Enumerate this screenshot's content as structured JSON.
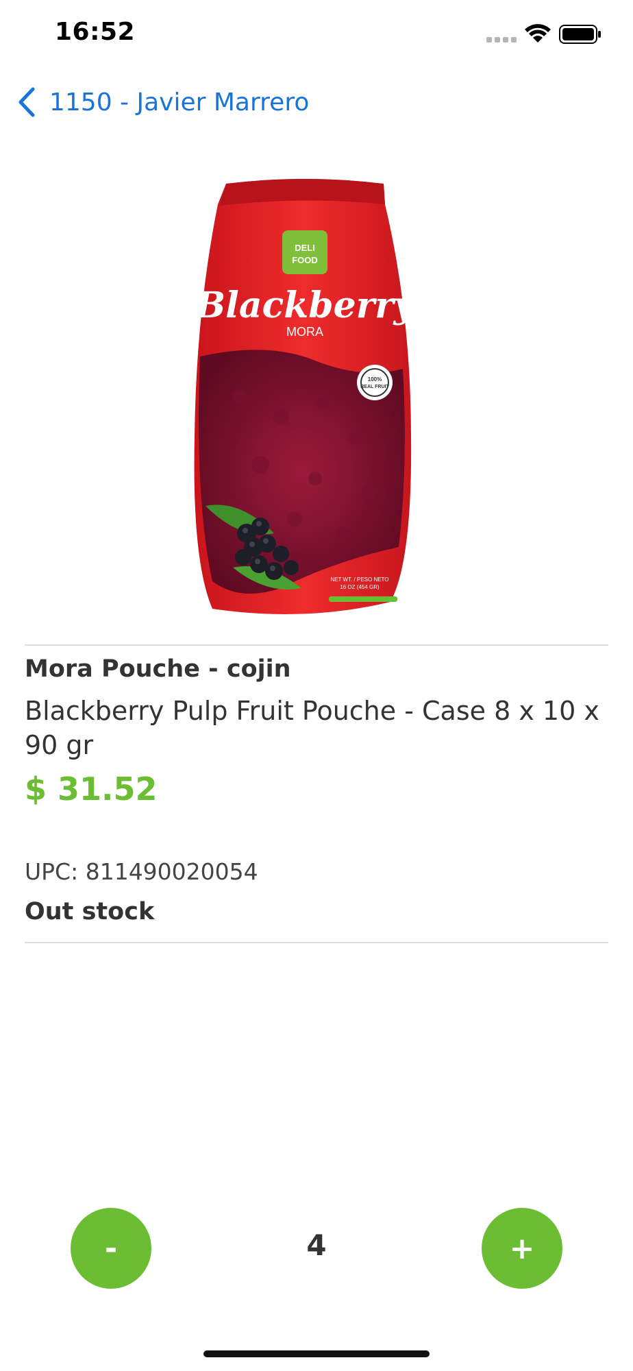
{
  "status_bar": {
    "time": "16:52",
    "icons": [
      "signal-icon",
      "wifi-icon",
      "battery-icon"
    ]
  },
  "nav": {
    "back_label": "1150 - Javier Marrero",
    "back_icon": "chevron-left-icon"
  },
  "product": {
    "image": {
      "brand_logo": "DELI FOOD",
      "name": "Blackberry",
      "subname": "MORA",
      "seal": "100% REAL FRUIT",
      "weight": "NET WT. / PESO NETO 16 OZ (454 GR)"
    },
    "short_name": "Mora Pouche - cojin",
    "full_name": "Blackberry Pulp Fruit Pouche - Case 8 x 10 x 90 gr",
    "price": "$ 31.52",
    "upc": "UPC: 811490020054",
    "stock_status": "Out stock"
  },
  "quantity": {
    "minus_label": "-",
    "value": "4",
    "plus_label": "+"
  },
  "colors": {
    "accent_green": "#6bbd33",
    "link_blue": "#1a73d9",
    "text": "#333333",
    "pouch_red": "#e02a2a"
  }
}
